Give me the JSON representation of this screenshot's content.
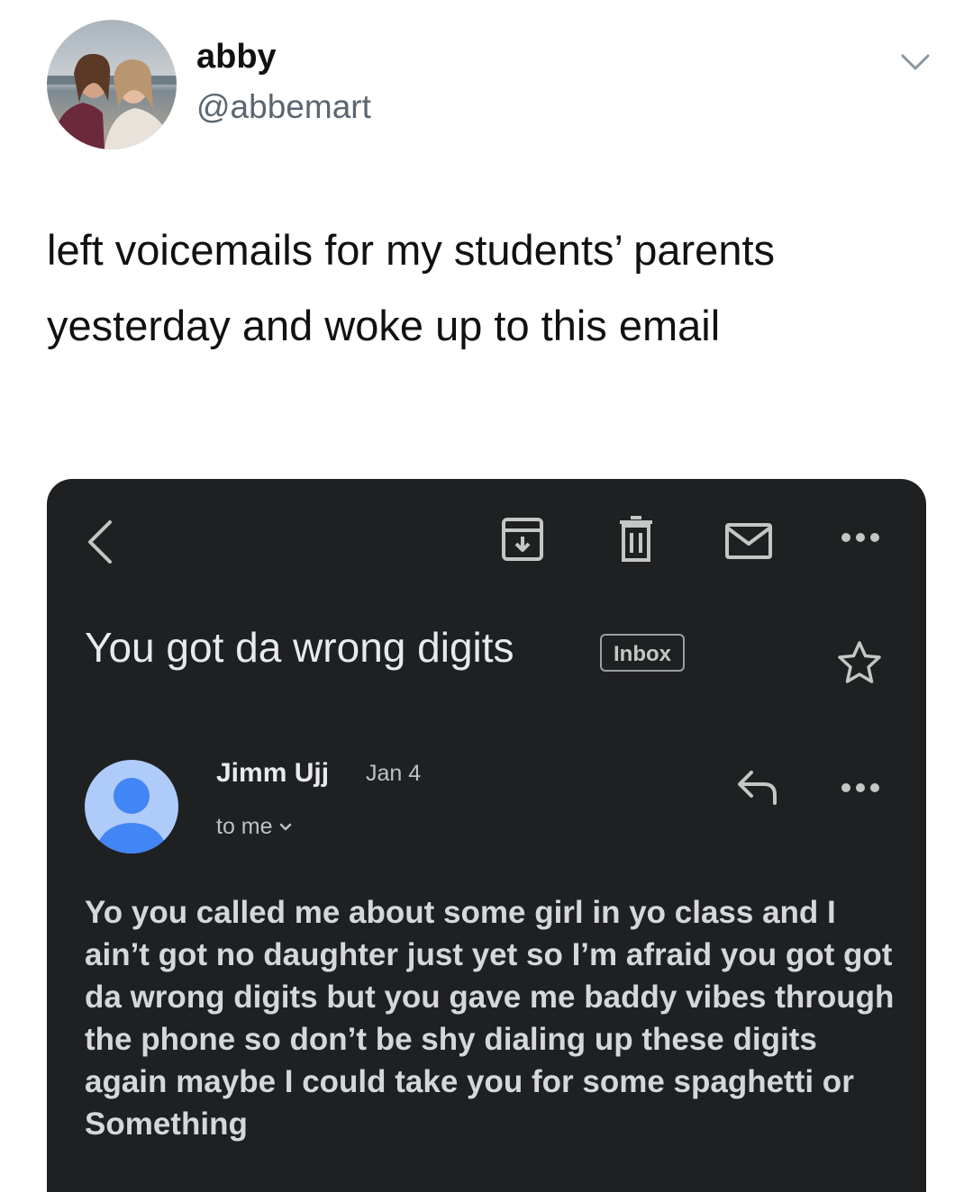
{
  "tweet": {
    "display_name": "abby",
    "handle": "@abbemart",
    "text": "left voicemails for my students’ parents yesterday and woke up to this email"
  },
  "email": {
    "subject": "You got da wrong digits",
    "label": "Inbox",
    "sender_name": "Jimm Ujj",
    "date": "Jan 4",
    "recipient": "to me",
    "body": "Yo you called me about some girl in yo class and I ain’t got no daughter just yet so I’m afraid you got got da wrong digits but you gave me baddy vibes through the phone so don’t be shy dialing up these digits again maybe I could take you for some spaghetti or Something"
  },
  "icons": {
    "tweet_menu": "chevron-down-icon",
    "back": "back-arrow-icon",
    "archive": "archive-icon",
    "delete": "trash-icon",
    "mark_unread": "mail-icon",
    "overflow": "more-horiz-icon",
    "star": "star-icon",
    "reply": "reply-icon",
    "avatar": "person-icon"
  },
  "colors": {
    "email_background": "#1f2022",
    "avatar_background": "#aecbfa",
    "avatar_figure": "#4285f4"
  }
}
